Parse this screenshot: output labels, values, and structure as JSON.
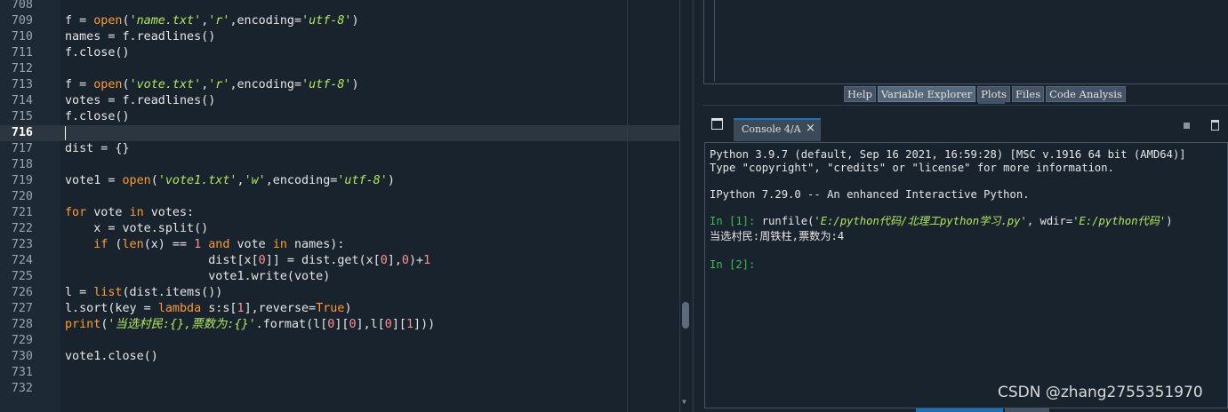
{
  "editor": {
    "current_line": 716,
    "lines": [
      {
        "n": "708",
        "tokens": []
      },
      {
        "n": "709",
        "tokens": [
          {
            "t": "f = "
          },
          {
            "t": "open",
            "c": "kw"
          },
          {
            "t": "("
          },
          {
            "t": "'name.txt'",
            "c": "str"
          },
          {
            "t": ","
          },
          {
            "t": "'r'",
            "c": "str"
          },
          {
            "t": ",encoding="
          },
          {
            "t": "'utf-8'",
            "c": "str"
          },
          {
            "t": ")"
          }
        ]
      },
      {
        "n": "710",
        "tokens": [
          {
            "t": "names = f.readlines()"
          }
        ]
      },
      {
        "n": "711",
        "tokens": [
          {
            "t": "f.close()"
          }
        ]
      },
      {
        "n": "712",
        "tokens": []
      },
      {
        "n": "713",
        "tokens": [
          {
            "t": "f = "
          },
          {
            "t": "open",
            "c": "kw"
          },
          {
            "t": "("
          },
          {
            "t": "'vote.txt'",
            "c": "str"
          },
          {
            "t": ","
          },
          {
            "t": "'r'",
            "c": "str"
          },
          {
            "t": ",encoding="
          },
          {
            "t": "'utf-8'",
            "c": "str"
          },
          {
            "t": ")"
          }
        ]
      },
      {
        "n": "714",
        "tokens": [
          {
            "t": "votes = f.readlines()"
          }
        ]
      },
      {
        "n": "715",
        "tokens": [
          {
            "t": "f.close()"
          }
        ]
      },
      {
        "n": "716",
        "tokens": []
      },
      {
        "n": "717",
        "tokens": [
          {
            "t": "dist = {}"
          }
        ]
      },
      {
        "n": "718",
        "tokens": []
      },
      {
        "n": "719",
        "tokens": [
          {
            "t": "vote1 = "
          },
          {
            "t": "open",
            "c": "kw"
          },
          {
            "t": "("
          },
          {
            "t": "'vote1.txt'",
            "c": "str"
          },
          {
            "t": ","
          },
          {
            "t": "'w'",
            "c": "str"
          },
          {
            "t": ",encoding="
          },
          {
            "t": "'utf-8'",
            "c": "str"
          },
          {
            "t": ")"
          }
        ]
      },
      {
        "n": "720",
        "tokens": []
      },
      {
        "n": "721",
        "tokens": [
          {
            "t": "for",
            "c": "kw"
          },
          {
            "t": " vote "
          },
          {
            "t": "in",
            "c": "kw"
          },
          {
            "t": " votes:"
          }
        ]
      },
      {
        "n": "722",
        "tokens": [
          {
            "t": "    x = vote.split()"
          }
        ]
      },
      {
        "n": "723",
        "tokens": [
          {
            "t": "    "
          },
          {
            "t": "if",
            "c": "kw"
          },
          {
            "t": " ("
          },
          {
            "t": "len",
            "c": "kw"
          },
          {
            "t": "(x) == "
          },
          {
            "t": "1",
            "c": "num"
          },
          {
            "t": " "
          },
          {
            "t": "and",
            "c": "kw"
          },
          {
            "t": " vote "
          },
          {
            "t": "in",
            "c": "kw"
          },
          {
            "t": " names):"
          }
        ]
      },
      {
        "n": "724",
        "tokens": [
          {
            "t": "                    dist[x["
          },
          {
            "t": "0",
            "c": "num"
          },
          {
            "t": "]] = dist.get(x["
          },
          {
            "t": "0",
            "c": "num"
          },
          {
            "t": "],"
          },
          {
            "t": "0",
            "c": "num"
          },
          {
            "t": ")+"
          },
          {
            "t": "1",
            "c": "num"
          }
        ]
      },
      {
        "n": "725",
        "tokens": [
          {
            "t": "                    vote1.write(vote)"
          }
        ]
      },
      {
        "n": "726",
        "tokens": [
          {
            "t": "l = "
          },
          {
            "t": "list",
            "c": "kw"
          },
          {
            "t": "(dist.items())"
          }
        ]
      },
      {
        "n": "727",
        "tokens": [
          {
            "t": "l.sort(key = "
          },
          {
            "t": "lambda",
            "c": "kw"
          },
          {
            "t": " s:s["
          },
          {
            "t": "1",
            "c": "num"
          },
          {
            "t": "],reverse="
          },
          {
            "t": "True",
            "c": "kw"
          },
          {
            "t": ")"
          }
        ]
      },
      {
        "n": "728",
        "tokens": [
          {
            "t": "print",
            "c": "kw"
          },
          {
            "t": "("
          },
          {
            "t": "'当选村民:{},票数为:{}'",
            "c": "str"
          },
          {
            "t": ".format(l["
          },
          {
            "t": "0",
            "c": "num"
          },
          {
            "t": "]["
          },
          {
            "t": "0",
            "c": "num"
          },
          {
            "t": "],l["
          },
          {
            "t": "0",
            "c": "num"
          },
          {
            "t": "]["
          },
          {
            "t": "1",
            "c": "num"
          },
          {
            "t": "]))"
          }
        ]
      },
      {
        "n": "729",
        "tokens": []
      },
      {
        "n": "730",
        "tokens": [
          {
            "t": "vote1.close()"
          }
        ]
      },
      {
        "n": "731",
        "tokens": []
      },
      {
        "n": "732",
        "tokens": []
      }
    ]
  },
  "pane_tabs": [
    {
      "label": "Help",
      "active": false
    },
    {
      "label": "Variable Explorer",
      "active": true
    },
    {
      "label": "Plots",
      "active": false
    },
    {
      "label": "Files",
      "active": false
    },
    {
      "label": "Code Analysis",
      "active": false
    }
  ],
  "console": {
    "tab_label": "Console 4/A",
    "close_glyph": "×",
    "banner_1": "Python 3.9.7 (default, Sep 16 2021, 16:59:28) [MSC v.1916 64 bit (AMD64)]",
    "banner_2": "Type \"copyright\", \"credits\" or \"license\" for more information.",
    "banner_3": "IPython 7.29.0 -- An enhanced Interactive Python.",
    "prompt_1": "In [1]: ",
    "cmd_fn": "runfile(",
    "cmd_arg1": "'E:/python代码/北理工python学习.py'",
    "cmd_mid": ", wdir=",
    "cmd_arg2": "'E:/python代码'",
    "cmd_end": ")",
    "output": "当选村民:周铁柱,票数为:4",
    "prompt_2": "In [2]:"
  },
  "watermark": "CSDN @zhang2755351970",
  "colors": {
    "background": "#19232d",
    "keyword": "#ff9b32",
    "string": "#b2e85c",
    "number": "#ff8f8f",
    "prompt": "#38c24a",
    "accent": "#1a72bb"
  },
  "icons": {
    "browse": "browse-tabs-icon",
    "stop": "stop-kernel-icon",
    "clear": "trash-icon"
  }
}
